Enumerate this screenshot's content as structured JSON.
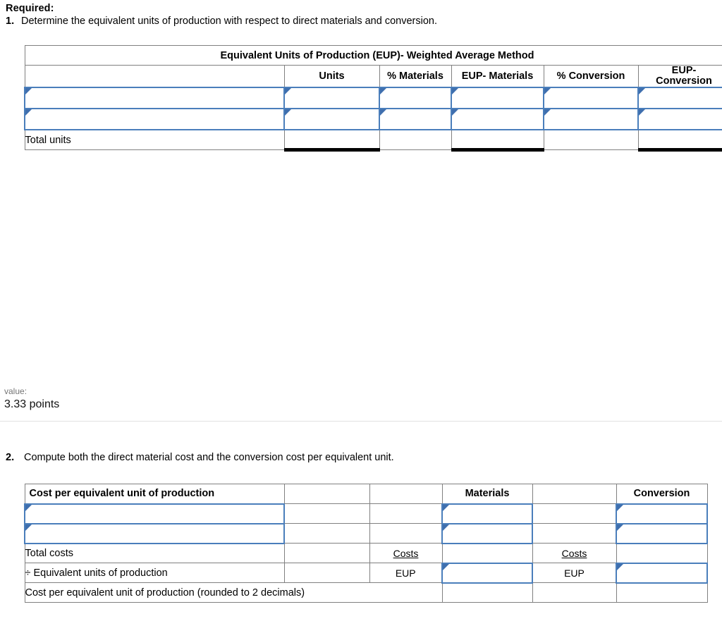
{
  "requirement": {
    "heading": "Required:",
    "item1_number": "1.",
    "item1_text": "Determine the equivalent units of production with respect to direct materials and conversion.",
    "item2_number": "2.",
    "item2_text": "Compute both the direct material cost and the conversion cost per equivalent unit."
  },
  "grade": {
    "value_label": "value:",
    "points": "3.33 points"
  },
  "table1": {
    "title": "Equivalent Units of Production (EUP)- Weighted Average Method",
    "columns": [
      {
        "label": ""
      },
      {
        "label": "Units"
      },
      {
        "label": "% Materials"
      },
      {
        "label": "EUP- Materials"
      },
      {
        "label": "% Conversion"
      },
      {
        "label": "EUP-\nConversion"
      }
    ],
    "col_eup_conversion_line1": "EUP-",
    "col_eup_conversion_line2": "Conversion",
    "input_rows": [
      {
        "label": "",
        "units": "",
        "pct_materials": "",
        "eup_materials": "",
        "pct_conversion": "",
        "eup_conversion": ""
      },
      {
        "label": "",
        "units": "",
        "pct_materials": "",
        "eup_materials": "",
        "pct_conversion": "",
        "eup_conversion": ""
      }
    ],
    "total_row": {
      "label": "Total units",
      "units": "",
      "pct_materials": "",
      "eup_materials": "",
      "pct_conversion": "",
      "eup_conversion": ""
    }
  },
  "table2": {
    "header": {
      "title": "Cost per equivalent unit of production",
      "blank1": "",
      "blank2": "",
      "materials": "Materials",
      "blank3": "",
      "conversion": "Conversion"
    },
    "input_rows": [
      {
        "label": "",
        "c2": "",
        "c3": "",
        "materials": "",
        "c5": "",
        "conversion": ""
      },
      {
        "label": "",
        "c2": "",
        "c3": "",
        "materials": "",
        "c5": "",
        "conversion": ""
      }
    ],
    "total_costs_row": {
      "label": "Total costs",
      "c2": "",
      "costs_materials_label": "Costs",
      "materials": "",
      "costs_conversion_label": "Costs",
      "conversion": ""
    },
    "eup_row": {
      "label": "÷ Equivalent units of production",
      "c2": "",
      "eup_materials_label": "EUP",
      "materials": "",
      "eup_conversion_label": "EUP",
      "conversion": ""
    },
    "cost_per_row": {
      "label": "Cost per equivalent unit of production (rounded to 2 decimals)",
      "materials": "",
      "c5": "",
      "conversion": ""
    }
  },
  "colors": {
    "header_blue": "#7eabe2",
    "input_border_blue": "#4a7ebb",
    "answer_yellow": "#fbfbb8",
    "grid_gray": "#808080",
    "divider_gray": "#e2e2e2"
  }
}
